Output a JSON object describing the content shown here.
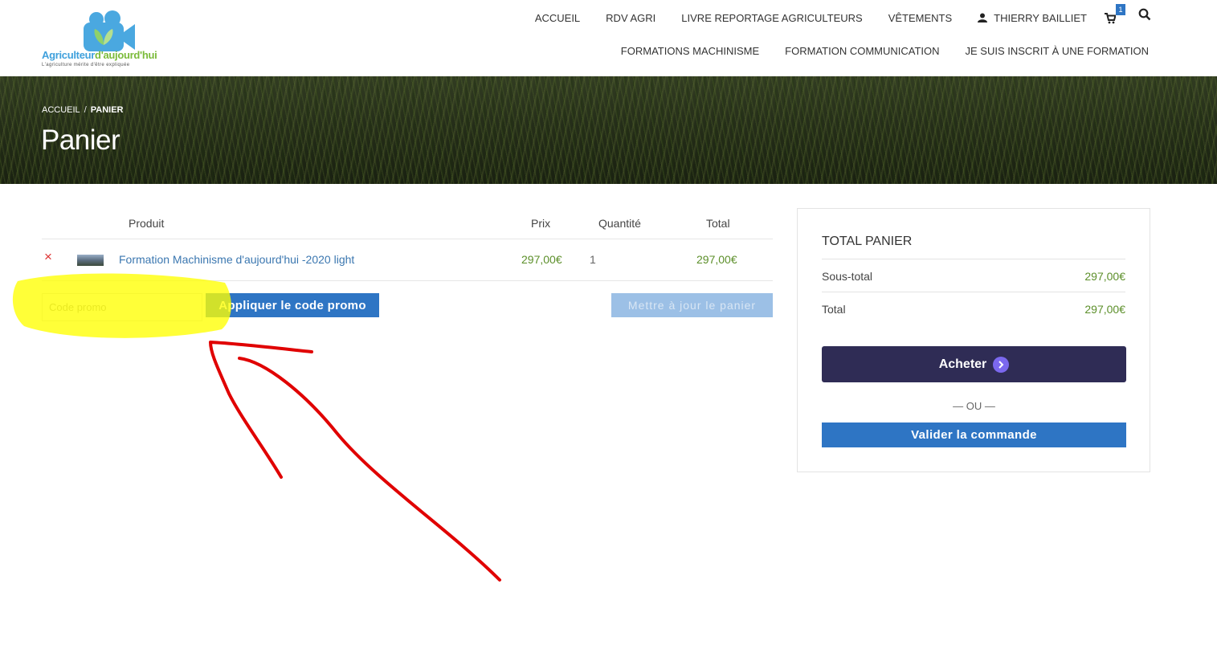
{
  "logo": {
    "name_part1": "Agriculteur",
    "name_part2": "d'aujourd'hui",
    "tagline": "L'agriculture mérite d'être expliquée"
  },
  "nav": {
    "row1": [
      "ACCUEIL",
      "RDV AGRI",
      "LIVRE REPORTAGE AGRICULTEURS",
      "VÊTEMENTS"
    ],
    "user": "THIERRY BAILLIET",
    "cart_count": "1",
    "row2": [
      "FORMATIONS MACHINISME",
      "FORMATION COMMUNICATION",
      "JE SUIS INSCRIT À UNE FORMATION"
    ]
  },
  "breadcrumb": {
    "home": "ACCUEIL",
    "separator": "/",
    "current": "PANIER"
  },
  "page_title": "Panier",
  "cart": {
    "headers": {
      "product": "Produit",
      "price": "Prix",
      "quantity": "Quantité",
      "total": "Total"
    },
    "items": [
      {
        "remove": "×",
        "name": "Formation Machinisme d'aujourd'hui -2020 light",
        "price": "297,00€",
        "quantity": "1",
        "total": "297,00€"
      }
    ],
    "promo_placeholder": "Code promo",
    "apply_label": "Appliquer le code promo",
    "update_label": "Mettre à jour le panier"
  },
  "totals": {
    "title": "TOTAL PANIER",
    "subtotal_label": "Sous-total",
    "subtotal_value": "297,00€",
    "total_label": "Total",
    "total_value": "297,00€",
    "buy_label": "Acheter",
    "or_label": "— OU —",
    "validate_label": "Valider la commande"
  },
  "colors": {
    "accent_blue": "#2e75c4",
    "price_green": "#5c8f2a",
    "buy_button": "#2f2c55",
    "highlight": "#ffff00",
    "annotation_arrow": "#e00000"
  }
}
